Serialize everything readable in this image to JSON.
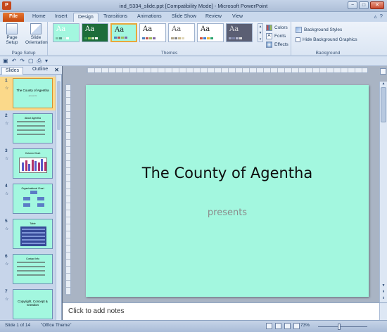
{
  "window": {
    "title": "ind_5334_slide.ppt [Compatibility Mode] - Microsoft PowerPoint",
    "app_icon": "P",
    "controls": [
      "−",
      "□",
      "✕"
    ]
  },
  "tabs": [
    {
      "label": "File"
    },
    {
      "label": "Home"
    },
    {
      "label": "Insert"
    },
    {
      "label": "Design"
    },
    {
      "label": "Transitions"
    },
    {
      "label": "Animations"
    },
    {
      "label": "Slide Show"
    },
    {
      "label": "Review"
    },
    {
      "label": "View"
    }
  ],
  "active_tab": "Design",
  "ribbon": {
    "page_setup": {
      "page_setup_label": "Page Setup",
      "orientation_label": "Slide Orientation",
      "group_label": "Page Setup"
    },
    "themes": {
      "group_label": "Themes",
      "gallery_glyph": "Aa",
      "items": [
        {
          "bg": "#a3f7df",
          "fg": "#ffffff",
          "swatches": [
            "#7fbfa8",
            "#5a9c8b",
            "#c7e8de",
            "#ffffff"
          ]
        },
        {
          "bg": "#1d6d3a",
          "fg": "#ffffff",
          "swatches": [
            "#3c9d5a",
            "#8bc34a",
            "#d9e8c4",
            "#ffffff"
          ]
        },
        {
          "bg": "#a3f7df",
          "fg": "#1a1a1a",
          "swatches": [
            "#4f81bd",
            "#c0504d",
            "#9bbb59",
            "#8064a2"
          ],
          "selected": true
        },
        {
          "bg": "#ffffff",
          "fg": "#1a1a1a",
          "swatches": [
            "#4f81bd",
            "#c0504d",
            "#9bbb59",
            "#8064a2"
          ]
        },
        {
          "bg": "#ffffff",
          "fg": "#555555",
          "swatches": [
            "#b0a58a",
            "#7f7f7f",
            "#c9b98d",
            "#e0d6b8"
          ]
        },
        {
          "bg": "#ffffff",
          "fg": "#1a1a1a",
          "swatches": [
            "#d2533a",
            "#3a7bd2",
            "#f2b233",
            "#2aa36b"
          ]
        },
        {
          "bg": "#5b5f73",
          "fg": "#dcdcdc",
          "swatches": [
            "#9ca4c2",
            "#7a82a6",
            "#b7bbd1",
            "#dcdcdc"
          ]
        }
      ]
    },
    "theme_options": [
      {
        "label": "Colors",
        "icon": "colors-icon"
      },
      {
        "label": "Fonts",
        "icon": "fonts-icon"
      },
      {
        "label": "Effects",
        "icon": "effects-icon"
      }
    ],
    "background": {
      "styles_label": "Background Styles",
      "hide_graphics_label": "Hide Background Graphics",
      "group_label": "Background"
    }
  },
  "slides_panel": {
    "tab_slides": "Slides",
    "tab_outline": "Outline",
    "close": "✕",
    "thumbnails": [
      {
        "num": "1",
        "title": "The County of Agentha",
        "sub": "presents",
        "kind": "title",
        "active": true
      },
      {
        "num": "2",
        "title": "About Agentha",
        "kind": "bullets"
      },
      {
        "num": "3",
        "title": "Column Chart",
        "kind": "chart"
      },
      {
        "num": "4",
        "title": "Organizational Chart",
        "kind": "org"
      },
      {
        "num": "5",
        "title": "Table",
        "kind": "table"
      },
      {
        "num": "6",
        "title": "Contact Info",
        "kind": "bullets"
      },
      {
        "num": "7",
        "title": "Copyright, Concept & Creation",
        "kind": "title"
      }
    ]
  },
  "slide": {
    "title": "The County of Agentha",
    "subtitle": "presents",
    "background": "#a3f7df"
  },
  "notes": {
    "placeholder": "Click to add notes"
  },
  "status": {
    "slide_info": "Slide 1 of 14",
    "theme": "\"Office Theme\"",
    "zoom": "73%"
  }
}
